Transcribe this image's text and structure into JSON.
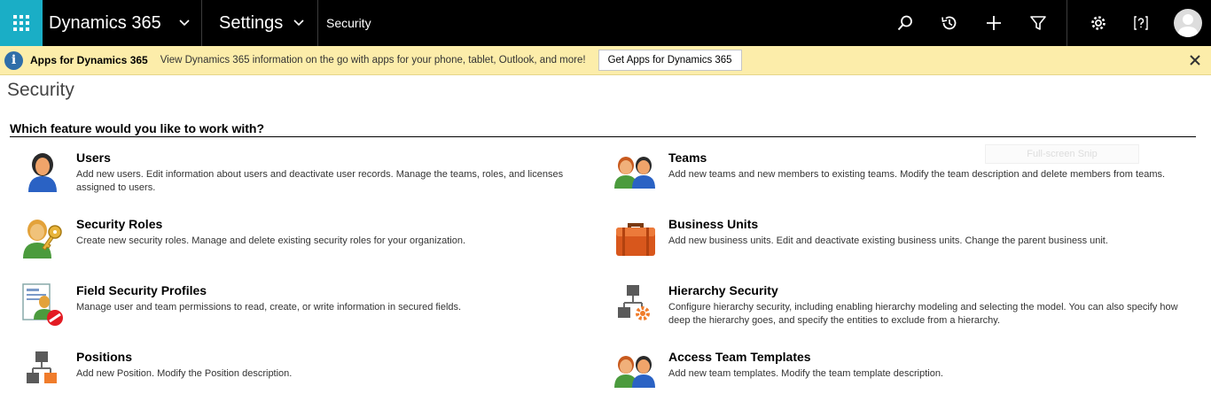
{
  "topbar": {
    "app_name": "Dynamics 365",
    "area": "Settings",
    "breadcrumb": "Security",
    "icons": [
      "waffle-icon",
      "search-icon",
      "history-icon",
      "plus-icon",
      "filter-icon",
      "gear-icon",
      "help-icon",
      "user-avatar"
    ]
  },
  "notification": {
    "title": "Apps for Dynamics 365",
    "message": "View Dynamics 365 information on the go with apps for your phone, tablet, Outlook, and more!",
    "button": "Get Apps for Dynamics 365"
  },
  "page": {
    "title": "Security",
    "question": "Which feature would you like to work with?",
    "overlay_text": "Full-screen Snip"
  },
  "features": {
    "users": {
      "title": "Users",
      "desc": "Add new users. Edit information about users and deactivate user records. Manage the teams, roles, and licenses assigned to users."
    },
    "teams": {
      "title": "Teams",
      "desc": "Add new teams and new members to existing teams. Modify the team description and delete members from teams."
    },
    "security_roles": {
      "title": "Security Roles",
      "desc": "Create new security roles. Manage and delete existing security roles for your organization."
    },
    "business_units": {
      "title": "Business Units",
      "desc": "Add new business units. Edit and deactivate existing business units. Change the parent business unit."
    },
    "field_security_profiles": {
      "title": "Field Security Profiles",
      "desc": "Manage user and team permissions to read, create, or write information in secured fields."
    },
    "hierarchy_security": {
      "title": "Hierarchy Security",
      "desc": "Configure hierarchy security, including enabling hierarchy modeling and selecting the model. You can also specify how deep the hierarchy goes, and specify the entities to exclude from a hierarchy."
    },
    "positions": {
      "title": "Positions",
      "desc": "Add new Position. Modify the Position description."
    },
    "access_team_templates": {
      "title": "Access Team Templates",
      "desc": "Add new team templates. Modify the team template description."
    }
  },
  "colors": {
    "waffle_bg": "#1aaec6",
    "topbar_bg": "#000000",
    "notification_bg": "#fcedaa",
    "info_icon": "#2f6ea9",
    "accent_orange": "#f07c2b"
  }
}
